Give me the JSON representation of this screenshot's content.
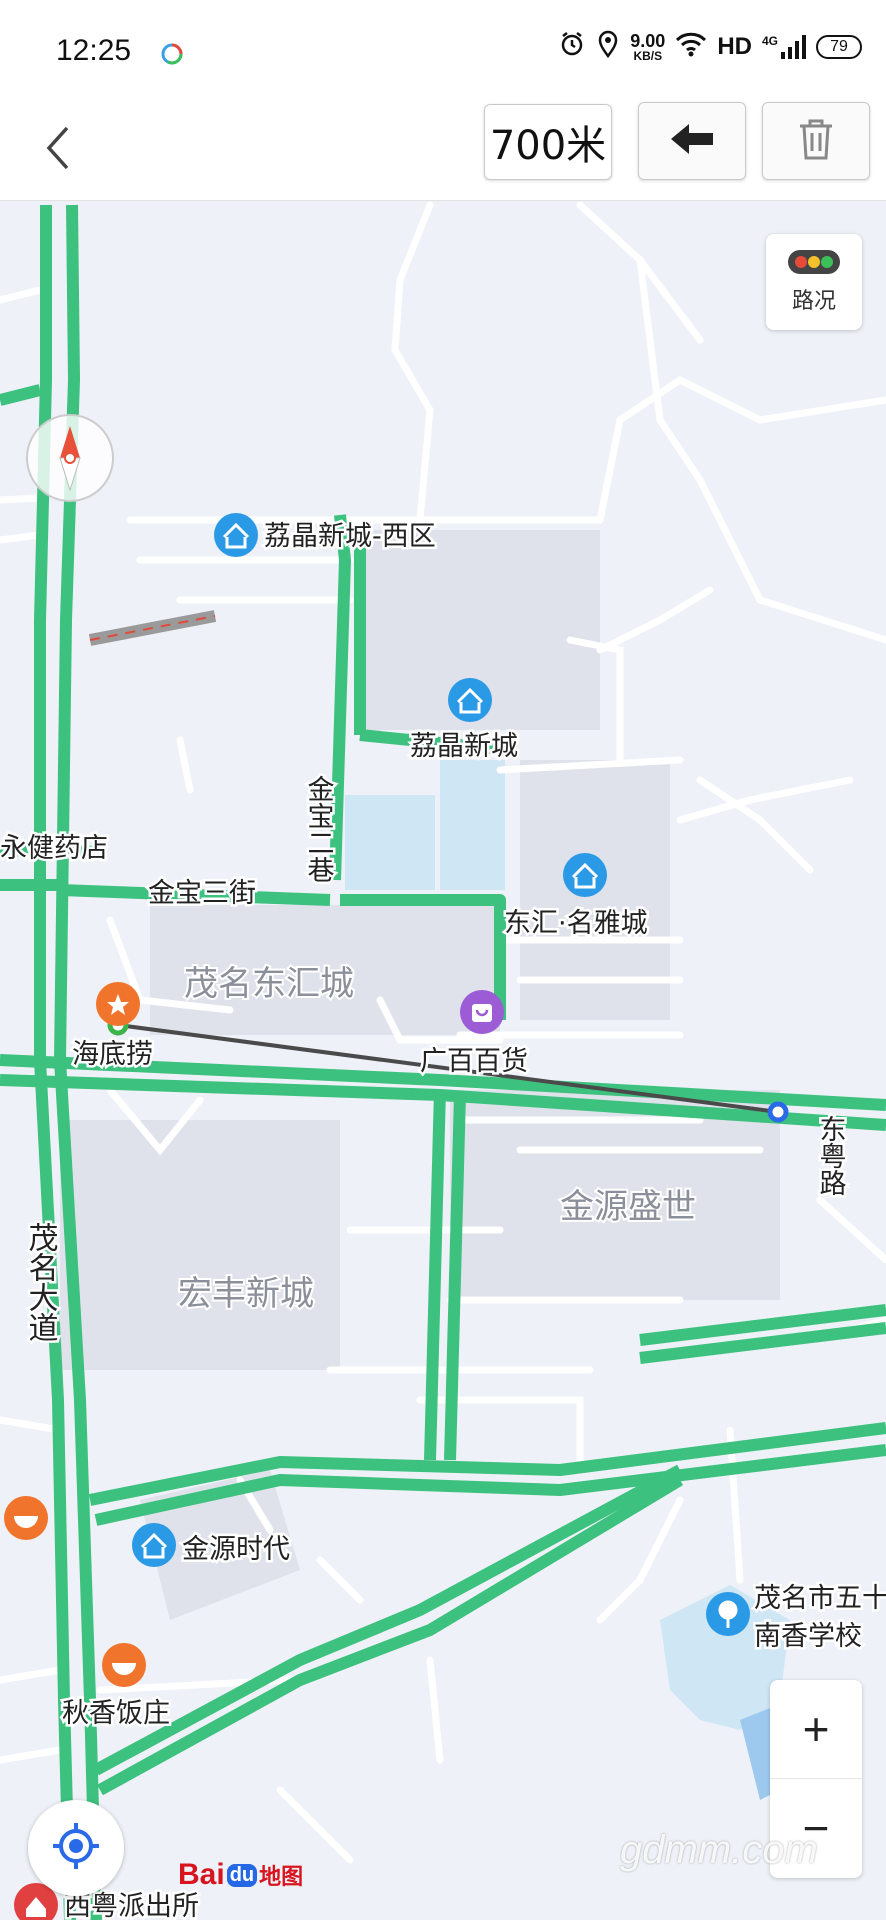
{
  "status_bar": {
    "time": "12:25",
    "net_speed_value": "9.00",
    "net_speed_unit": "KB/S",
    "hd": "HD",
    "network": "4G",
    "battery": "79"
  },
  "toolbar": {
    "distance": "700米",
    "back_icon": "chevron-left-icon",
    "undo_icon": "arrow-left-icon",
    "delete_icon": "trash-icon"
  },
  "map": {
    "traffic_label": "路况",
    "zoom_in_label": "+",
    "zoom_out_label": "−",
    "roads": {
      "maoming_avenue": "茂名大道",
      "jinbao_3rd": "金宝三街",
      "jinbao_lane": "金宝二巷",
      "dongyue_road": "东粤路"
    },
    "places": {
      "lijing_west": "荔晶新城-西区",
      "lijing": "荔晶新城",
      "donghui_mingya": "东汇·名雅城",
      "maoming_donghui": "茂名东汇城",
      "guangbai": "广百百货",
      "haidilao": "海底捞",
      "pharmacy": "永健药店",
      "jinyuan_shengshi": "金源盛世",
      "hongfeng": "宏丰新城",
      "jinyuan_shidai": "金源时代",
      "school": [
        "茂名市五十",
        "南香学校"
      ],
      "qiuxiang": "秋香饭庄",
      "police": "西粤派出所"
    },
    "logo": {
      "part1": "Bai",
      "part2": "du",
      "part3": "地图"
    },
    "watermark": "gdmm.com",
    "colors": {
      "road_green": "#3dc17e",
      "congestion_red": "#d9182a",
      "poi_blue": "#2a9ae6",
      "poi_orange": "#f0742c",
      "poi_purple": "#9b5cd6",
      "measure_line": "#4a4a4a"
    }
  }
}
